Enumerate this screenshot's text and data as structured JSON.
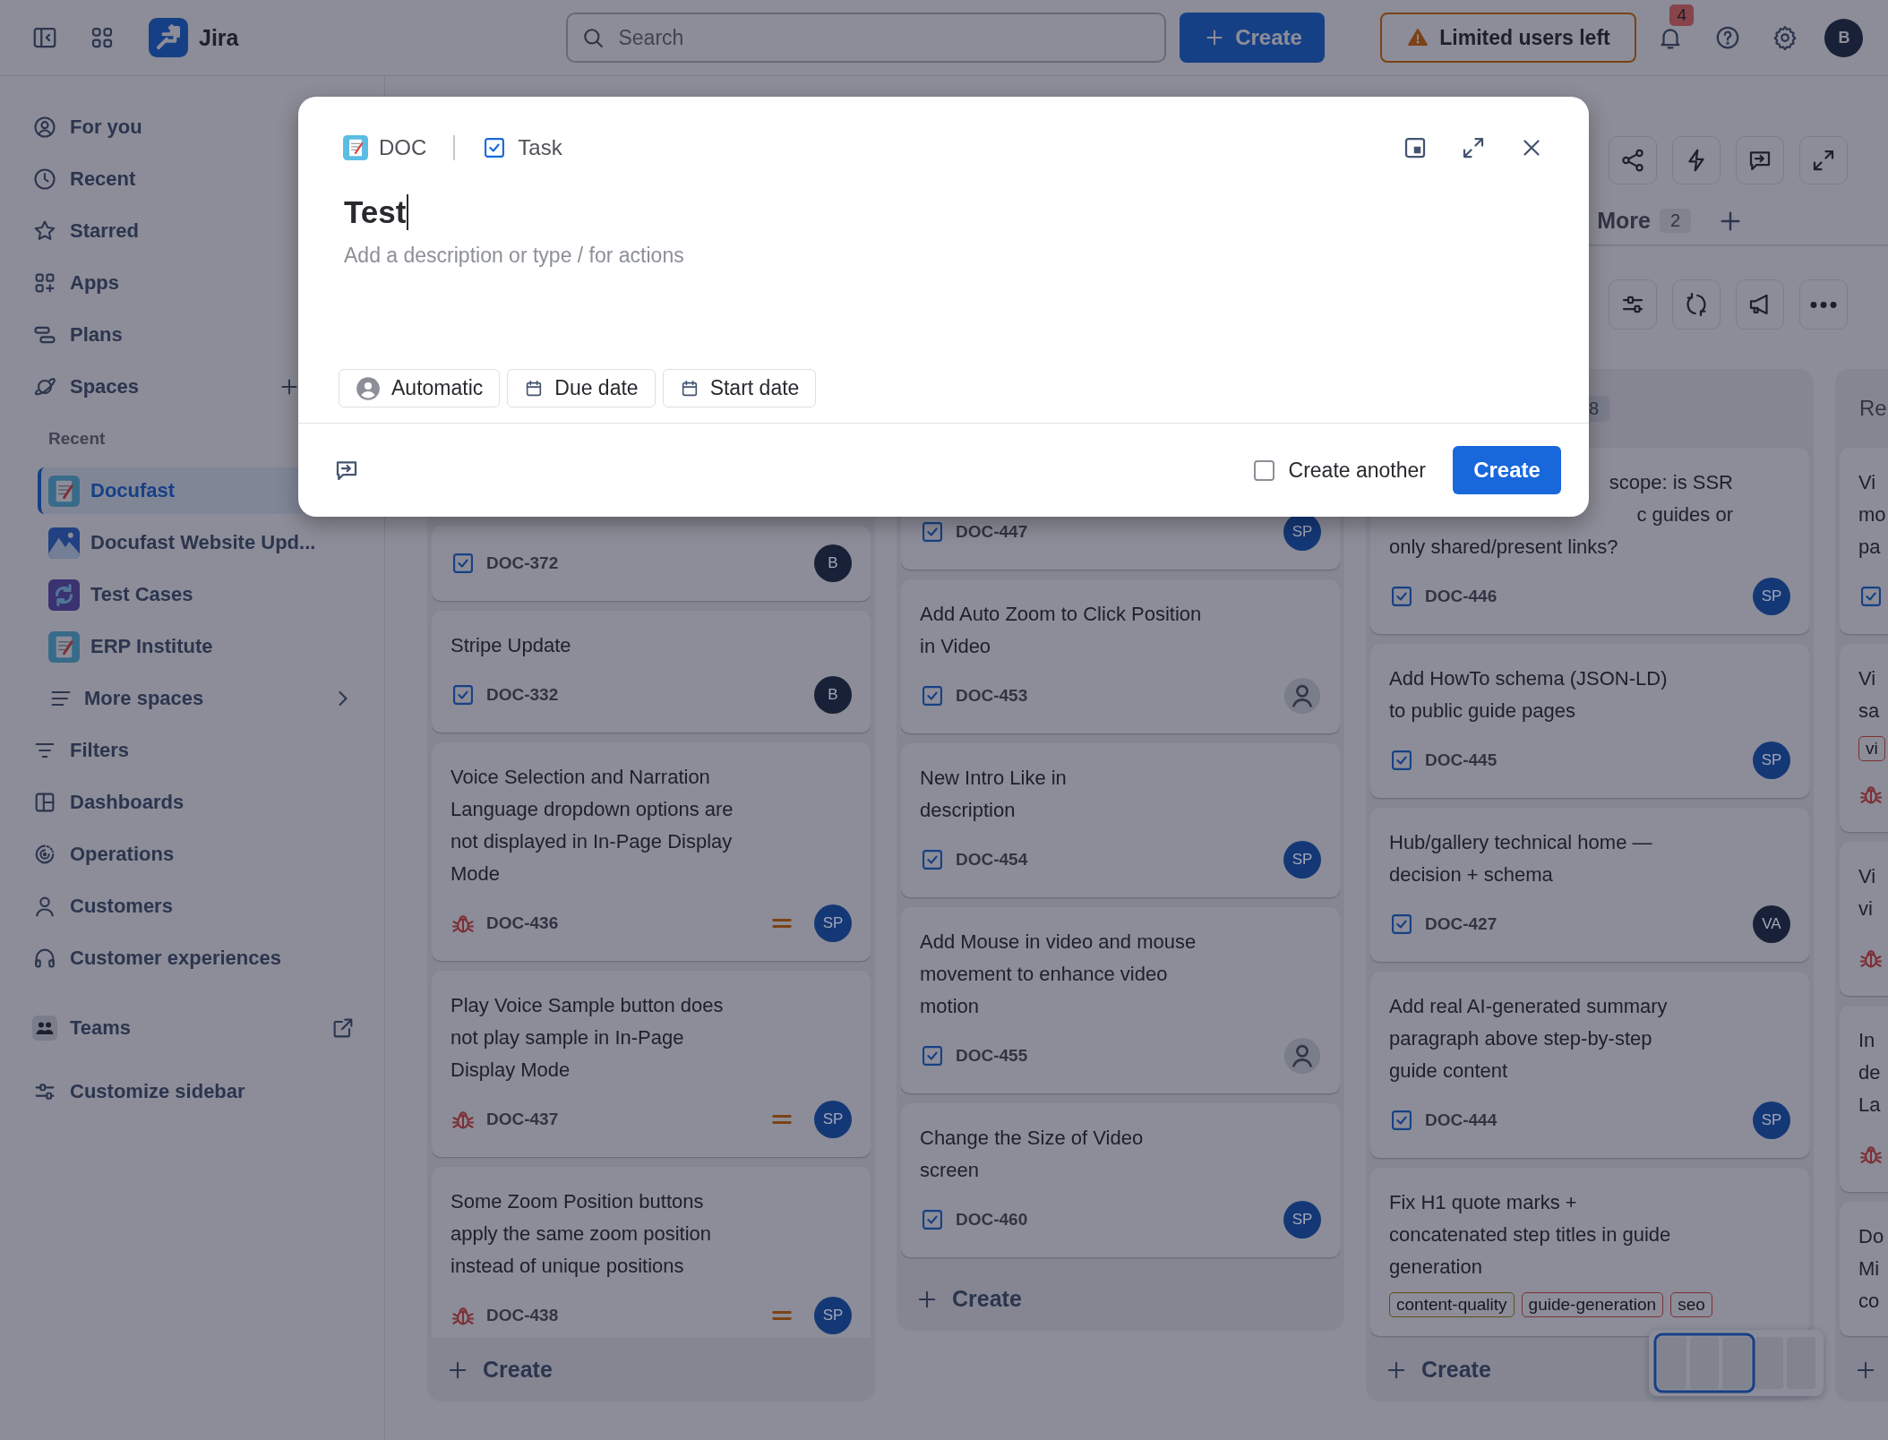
{
  "top_bar": {
    "product": "Jira",
    "search": {
      "placeholder": "Search"
    },
    "create": "Create",
    "alert": "Limited users left",
    "notifications": "4",
    "avatar": "B"
  },
  "sidebar": {
    "nav": [
      {
        "label": "For you"
      },
      {
        "label": "Recent"
      },
      {
        "label": "Starred"
      },
      {
        "label": "Apps"
      },
      {
        "label": "Plans"
      },
      {
        "label": "Spaces"
      }
    ],
    "recent_heading": "Recent",
    "spaces": [
      {
        "label": "Docufast",
        "selected": true
      },
      {
        "label": "Docufast Website Upd...",
        "selected": false
      },
      {
        "label": "Test Cases",
        "selected": false
      },
      {
        "label": "ERP Institute",
        "selected": false
      }
    ],
    "more_spaces": "More spaces",
    "nav_more": [
      {
        "label": "Filters"
      },
      {
        "label": "Dashboards"
      },
      {
        "label": "Operations"
      },
      {
        "label": "Customers"
      },
      {
        "label": "Customer experiences"
      }
    ],
    "teams": "Teams",
    "customize": "Customize sidebar"
  },
  "view_tabs": [
    {
      "label": "More",
      "count": "2"
    }
  ],
  "board": {
    "columns": [
      {
        "cards": [
          {
            "key": "DOC-372",
            "kind": "task",
            "assignee": {
              "kind": "initials",
              "initials": "B",
              "color": "#182137"
            }
          },
          {
            "title": "Stripe Update",
            "key": "DOC-332",
            "kind": "task",
            "assignee": {
              "kind": "initials",
              "initials": "B",
              "color": "#182137"
            }
          },
          {
            "title": "Voice Selection and Narration Language dropdown options are not displayed in In-Page Display Mode",
            "key": "DOC-436",
            "kind": "bug",
            "priority": {
              "kind": "medium"
            },
            "assignee": {
              "kind": "initials",
              "initials": "SP",
              "color": "#143876"
            }
          },
          {
            "title": "Play Voice Sample button does not play sample in In-Page Display Mode",
            "key": "DOC-437",
            "kind": "bug",
            "priority": {
              "kind": "medium"
            },
            "assignee": {
              "kind": "initials",
              "initials": "SP",
              "color": "#143876"
            }
          },
          {
            "title": "Some Zoom Position buttons apply the same zoom position instead of unique positions",
            "key": "DOC-438",
            "kind": "bug",
            "priority": {
              "kind": "medium"
            },
            "assignee": {
              "kind": "initials",
              "initials": "SP",
              "color": "#143876"
            }
          }
        ],
        "create_label": "Create"
      },
      {
        "cards": [
          {
            "key": "DOC-447",
            "kind": "task",
            "assignee": {
              "kind": "initials",
              "initials": "SP",
              "color": "#143876"
            }
          },
          {
            "title": "Add Auto Zoom to Click Position in Video",
            "key": "DOC-453",
            "kind": "task",
            "assignee": {
              "kind": "unassigned"
            }
          },
          {
            "title": "New Intro Like in\ndescription",
            "key": "DOC-454",
            "kind": "task",
            "assignee": {
              "kind": "initials",
              "initials": "SP",
              "color": "#143876"
            }
          },
          {
            "title": "Add Mouse in video and mouse movement to enhance video motion",
            "key": "DOC-455",
            "kind": "task",
            "assignee": {
              "kind": "unassigned"
            }
          },
          {
            "title": "Change the Size of Video\nscreen",
            "key": "DOC-460",
            "kind": "task",
            "assignee": {
              "kind": "initials",
              "initials": "SP",
              "color": "#143876"
            }
          }
        ],
        "create_label": "Create"
      },
      {
        "count": "8",
        "cards": [
          {
            "fragment": "scope: is SSR\nc guides or",
            "title": "only shared/present links?",
            "key": "DOC-446",
            "kind": "task",
            "assignee": {
              "kind": "initials",
              "initials": "SP",
              "color": "#143876"
            }
          },
          {
            "title": "Add HowTo schema (JSON-LD) to public guide pages",
            "key": "DOC-445",
            "kind": "task",
            "assignee": {
              "kind": "initials",
              "initials": "SP",
              "color": "#143876"
            }
          },
          {
            "title": "Hub/gallery technical home — decision + schema",
            "key": "DOC-427",
            "kind": "task",
            "assignee": {
              "kind": "initials",
              "initials": "VA",
              "color": "#182137"
            }
          },
          {
            "title": "Add real AI-generated summary paragraph above step-by-step guide content",
            "key": "DOC-444",
            "kind": "task",
            "assignee": {
              "kind": "initials",
              "initials": "SP",
              "color": "#143876"
            }
          },
          {
            "title": "Fix H1 quote marks + concatenated step titles in guide generation",
            "tags": [
              {
                "label": "content-quality",
                "color": "#654f16"
              },
              {
                "label": "guide-generation",
                "color": "#7d3035"
              },
              {
                "label": "seo",
                "color": "#7d3035"
              }
            ]
          }
        ],
        "create_label": "Create"
      },
      {
        "title": "Re",
        "cards": [
          {
            "title": "Vi\nmo\npa",
            "kind": "task"
          },
          {
            "title": "Vi\nsa",
            "tags": [
              {
                "label": "vi",
                "color": "#7d3035"
              }
            ],
            "kind": "bug"
          },
          {
            "title": "Vi\nvi",
            "kind": "bug"
          },
          {
            "title": "In\nde\nLa",
            "kind": "bug"
          },
          {
            "title": "Do\nMi\nco"
          }
        ]
      }
    ]
  },
  "dialog": {
    "space": "DOC",
    "issue_type": "Task",
    "summary": "Test",
    "description_placeholder": "Add a description or type / for actions",
    "fields": [
      {
        "label": "Automatic"
      },
      {
        "label": "Due date"
      },
      {
        "label": "Start date"
      }
    ],
    "create_another": {
      "label": "Create another",
      "checked": false
    },
    "submit": "Create"
  }
}
